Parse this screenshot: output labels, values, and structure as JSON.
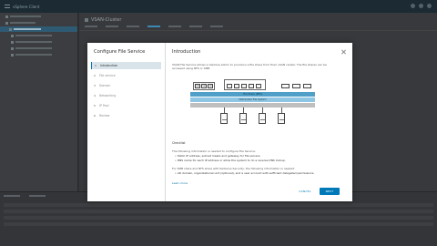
{
  "app": {
    "title": "vSphere Client",
    "object_name": "VSAN-Cluster"
  },
  "wizard": {
    "title": "Configure File Service",
    "steps": [
      {
        "num": "1",
        "label": "Introduction",
        "active": true
      },
      {
        "num": "2",
        "label": "File service"
      },
      {
        "num": "3",
        "label": "Domain"
      },
      {
        "num": "4",
        "label": "Networking"
      },
      {
        "num": "5",
        "label": "IP Pool"
      },
      {
        "num": "6",
        "label": "Review"
      }
    ],
    "page_title": "Introduction",
    "description": "VSAN File Service allows a vSphere admin to provision a file share from their vSAN cluster. The file shares can be accessed using NFS or SMB.",
    "diagram": {
      "layer1": "File Share (NFS)",
      "layer2": "Distributed File System",
      "vm_labels": [
        "VM",
        "VM",
        "VM"
      ]
    },
    "checklist_title": "Checklist",
    "checklist_intro": "The following information is needed to configure File Service:",
    "bullet1": "• Static IP address, subnet masks and gateway for file servers.",
    "bullet2": "• DNS name for each IP address or allow the system to do a reverse DNS lookup.",
    "ad_intro": "For SMB share and NFS share with Kerberos Security, the following information is needed:",
    "bullet3": "• AD domain, organizational unit (optional), and a user account with sufficient delegated permissions.",
    "learn_more": "Learn more",
    "cancel_label": "CANCEL",
    "next_label": "NEXT"
  },
  "colors": {
    "accent": "#0079b8",
    "bar_primary": "#4f9fc9",
    "bar_secondary": "#8fc6e3"
  }
}
